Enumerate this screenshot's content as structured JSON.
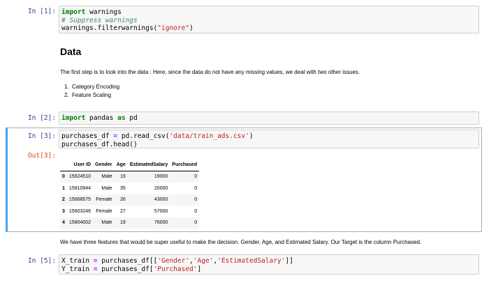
{
  "cells": {
    "c1": {
      "prompt": "In [1]:",
      "lines": [
        [
          {
            "t": "import",
            "c": "kw"
          },
          {
            "t": " warnings",
            "c": ""
          }
        ],
        [
          {
            "t": "# Suppress warnings",
            "c": "cm"
          }
        ],
        [
          {
            "t": "warnings.filterwarnings(",
            "c": ""
          },
          {
            "t": "\"ignore\"",
            "c": "st"
          },
          {
            "t": ")",
            "c": ""
          }
        ]
      ]
    },
    "markdown": {
      "heading": "Data",
      "paragraph": "The first step is to look into the data : Here, since the data do not have any missing values, we deal with two other issues.",
      "list": [
        {
          "num": "1.",
          "text": "Category Encoding"
        },
        {
          "num": "2.",
          "text": "Feature Scaling"
        }
      ]
    },
    "c2": {
      "prompt": "In [2]:",
      "lines": [
        [
          {
            "t": "import",
            "c": "kw"
          },
          {
            "t": " pandas ",
            "c": ""
          },
          {
            "t": "as",
            "c": "kw"
          },
          {
            "t": " pd",
            "c": ""
          }
        ]
      ]
    },
    "c3": {
      "prompt": "In [3]:",
      "lines": [
        [
          {
            "t": "purchases_df ",
            "c": ""
          },
          {
            "t": "=",
            "c": "op"
          },
          {
            "t": " pd.read_csv(",
            "c": ""
          },
          {
            "t": "'data/train_ads.csv'",
            "c": "st"
          },
          {
            "t": ")",
            "c": ""
          }
        ],
        [
          {
            "t": "purchases_df.head()",
            "c": ""
          }
        ]
      ],
      "out_prompt": "Out[3]:",
      "table": {
        "columns": [
          "",
          "User ID",
          "Gender",
          "Age",
          "EstimatedSalary",
          "Purchased"
        ],
        "rows": [
          [
            "0",
            "15624510",
            "Male",
            "19",
            "19000",
            "0"
          ],
          [
            "1",
            "15810944",
            "Male",
            "35",
            "20000",
            "0"
          ],
          [
            "2",
            "15668575",
            "Female",
            "26",
            "43000",
            "0"
          ],
          [
            "3",
            "15603246",
            "Female",
            "27",
            "57000",
            "0"
          ],
          [
            "4",
            "15804002",
            "Male",
            "19",
            "76000",
            "0"
          ]
        ]
      }
    },
    "markdown2": {
      "paragraph": "We have three features that would be super useful to make the decision. Gender, Age, and Estimated Salary. Our Target is the column Purchased."
    },
    "c5": {
      "prompt": "In [5]:",
      "lines": [
        [
          {
            "t": "X_train ",
            "c": ""
          },
          {
            "t": "=",
            "c": "op"
          },
          {
            "t": " purchases_df[[",
            "c": ""
          },
          {
            "t": "'Gender'",
            "c": "st"
          },
          {
            "t": ",",
            "c": ""
          },
          {
            "t": "'Age'",
            "c": "st"
          },
          {
            "t": ",",
            "c": ""
          },
          {
            "t": "'EstimatedSalary'",
            "c": "st"
          },
          {
            "t": "]]",
            "c": ""
          }
        ],
        [
          {
            "t": "Y_train ",
            "c": ""
          },
          {
            "t": "=",
            "c": "op"
          },
          {
            "t": " purchases_df[",
            "c": ""
          },
          {
            "t": "'Purchased'",
            "c": "st"
          },
          {
            "t": "]",
            "c": ""
          }
        ]
      ]
    }
  },
  "colors": {
    "selected_cell_bar": "#42a5f5",
    "in_prompt": "#303f9f",
    "out_prompt": "#d84315",
    "keyword": "#008000",
    "string": "#ba2121",
    "comment": "#408080"
  }
}
